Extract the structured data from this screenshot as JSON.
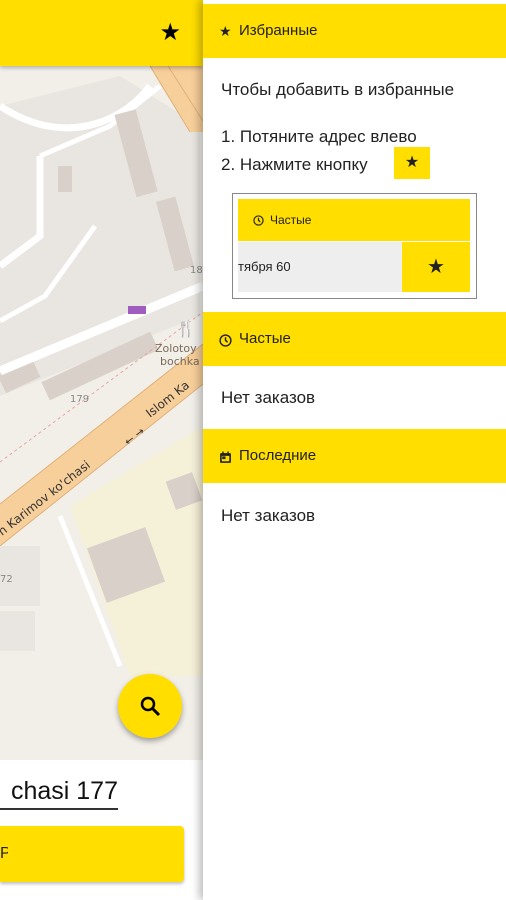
{
  "map": {
    "street_label": "n Karimov ko'chasi",
    "street_label_2": "Islom Ka",
    "poi_name_1": "Zolotoy",
    "poi_name_2": "bochka",
    "house_179": "179",
    "house_18": "18",
    "house_72": "72"
  },
  "topbar": {
    "favorite_icon": "star-icon"
  },
  "search_fab": {
    "icon": "search-icon"
  },
  "bottom": {
    "address_value": "chasi 177",
    "order_button_label": "Р"
  },
  "drawer": {
    "favorites": {
      "icon": "★",
      "title": "Избранные",
      "instruction": "Чтобы добавить в избранные",
      "step1": "1. Потяните адрес влево",
      "step2": "2. Нажмите кнопку",
      "step2_button_icon": "★"
    },
    "example": {
      "header_icon": "clock-icon",
      "header_label": "Частые",
      "row_text": "тября 60",
      "row_star": "★"
    },
    "frequent": {
      "icon": "clock-icon",
      "title": "Частые",
      "empty_text": "Нет заказов"
    },
    "recent": {
      "icon": "calendar-icon",
      "title": "Последние",
      "empty_text": "Нет заказов"
    }
  },
  "colors": {
    "accent": "#ffde00",
    "map_bg": "#f2efe9",
    "road": "#f7cf9a"
  }
}
